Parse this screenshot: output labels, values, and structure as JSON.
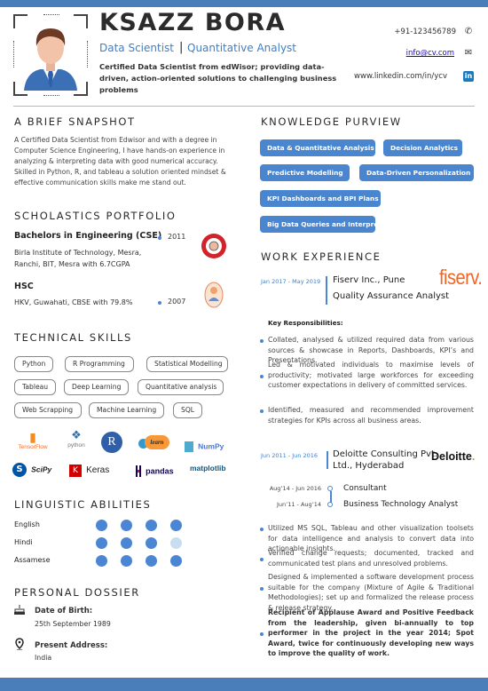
{
  "header": {
    "name": "KSAZZ BORA",
    "title_primary": "Data Scientist",
    "title_separator": "|",
    "title_secondary": "Quantitative Analyst",
    "tagline": "Certified Data Scientist from edWisor; providing data-driven, action-oriented solutions to challenging business problems",
    "contacts": [
      {
        "text": "+91-123456789",
        "icon": "phone-icon"
      },
      {
        "text": "info@cv.com",
        "icon": "envelope-icon"
      },
      {
        "text": "www.linkedin.com/in/ycv",
        "icon": "linkedin-icon"
      }
    ],
    "accent_color": "#4a7ebb"
  },
  "snapshot": {
    "heading": "A BRIEF SNAPSHOT",
    "text": "A Certified Data Scientist from Edwisor and with a degree in Computer Science Engineering, I have hands-on experience in analyzing & interpreting data with good numerical accuracy. Skilled in Python, R, and tableau a solution oriented mindset & effective communication skills make me stand out."
  },
  "education": {
    "heading": "SCHOLASTICS  PORTFOLIO",
    "items": [
      {
        "title": "Bachelors in Engineering (CSE)",
        "line1": "Birla Institute of Technology, Mesra,",
        "line2": "Ranchi, BIT, Mesra with 6.7CGPA",
        "year": "2011"
      },
      {
        "title": "HSC",
        "line1": "HKV, Guwahati, CBSE with 79.8%",
        "line2": "",
        "year": "2007"
      }
    ]
  },
  "technical_skills": {
    "heading": "TECHNICAL SKILLS",
    "skills": [
      "Python",
      "R Programming",
      "Statistical Modelling",
      "Tableau",
      "Deep Learning",
      "Quantitative analysis",
      "Web Scrapping",
      "Machine Learning",
      "SQL"
    ],
    "tool_logos": [
      "TensorFlow",
      "python",
      "R",
      "learn",
      "NumPy",
      "SciPy",
      "Keras",
      "pandas",
      "matplotlib"
    ]
  },
  "languages": {
    "heading": "LINGUISTIC  ABILITIES",
    "items": [
      {
        "name": "English",
        "level": 4,
        "max": 4
      },
      {
        "name": "Hindi",
        "level": 3,
        "max": 4
      },
      {
        "name": "Assamese",
        "level": 4,
        "max": 4
      }
    ],
    "filled_color": "#4a86d4",
    "empty_color": "#c9ddf0"
  },
  "personal": {
    "heading": "PERSONAL  DOSSIER",
    "dob_label": "Date of Birth:",
    "dob_value": "25th September 1989",
    "address_label": "Present  Address:",
    "address_value": "India"
  },
  "knowledge": {
    "heading": "KNOWLEDGE   PURVIEW",
    "pills": [
      "Data & Quantitative Analysis",
      "Decision Analytics",
      "Predictive Modelling",
      "Data-Driven Personalization",
      "KPI Dashboards and BPI Plans",
      "Big Data Queries and Interpretation"
    ]
  },
  "experience": {
    "heading": "WORK  EXPERIENCE",
    "jobs": [
      {
        "dates": "Jan 2017 - May 2019",
        "company": "Fiserv Inc., Pune",
        "role": "Quality Assurance Analyst",
        "logo": "fiserv.",
        "logo_color": "#f26522",
        "resp_heading": "Key Responsibilities:",
        "responsibilities": [
          "Collated, analysed & utilized required data from various sources & showcase in Reports, Dashboards, KPI’s and Presentations.",
          "Led & motivated individuals to maximise levels of productivity; motivated large workforces for exceeding customer expectations in delivery of committed services.",
          "Identified, measured and recommended improvement strategies for KPIs across all business areas."
        ]
      },
      {
        "dates": "Jun 2011 - Jun 2016",
        "company_line1": "Deloitte Consulting Pvt.",
        "company_line2": "Ltd., Hyderabad",
        "logo": "Deloitte",
        "logo_dot": ".",
        "logo_dot_color": "#86bc25",
        "timeline": [
          {
            "dates": "Aug’14 - Jun 2016",
            "role": "Consultant"
          },
          {
            "dates": "Jun’11 - Aug’14",
            "role": "Business Technology Analyst"
          }
        ],
        "responsibilities": [
          "Utilized MS SQL, Tableau and other visualization toolsets for data intelligence and analysis to convert data into actionable insights.",
          "Verified change requests; documented, tracked and communicated test plans and unresolved problems.",
          "Designed & implemented a software development process suitable for the company (Mixture of Agile & Traditional Methodologies); set up and formalized the release process & release strategy.",
          "Recipient of Applause Award and Positive Feedback from the leadership, given bi-annually to top performer in the project in the year 2014; Spot Award, twice for continuously developing new ways to improve the quality of work."
        ]
      }
    ]
  }
}
